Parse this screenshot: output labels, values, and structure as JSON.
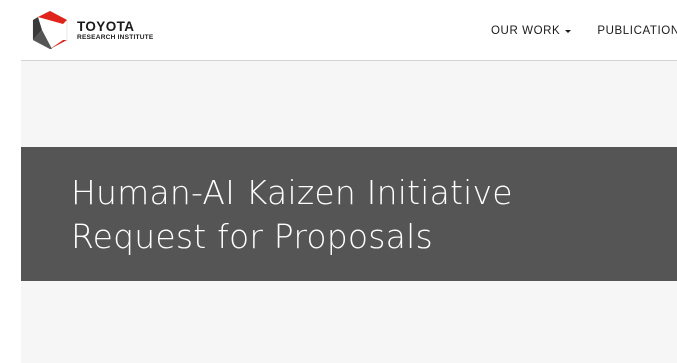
{
  "header": {
    "logo": {
      "brand": "TOYOTA",
      "sub": "RESEARCH INSTITUTE",
      "colors": {
        "red": "#e0241b",
        "dark": "#3a3a3a"
      }
    },
    "nav": [
      {
        "label": "OUR WORK",
        "has_dropdown": true,
        "icon": "caret-down-icon"
      },
      {
        "label": "PUBLICATIONS",
        "has_dropdown": false
      }
    ]
  },
  "hero": {
    "title_line1": "Human-AI Kaizen Initiative",
    "title_line2": "Request for Proposals",
    "background": "#555555",
    "text_color": "#ffffff"
  },
  "page": {
    "band_color": "#f6f6f6"
  }
}
